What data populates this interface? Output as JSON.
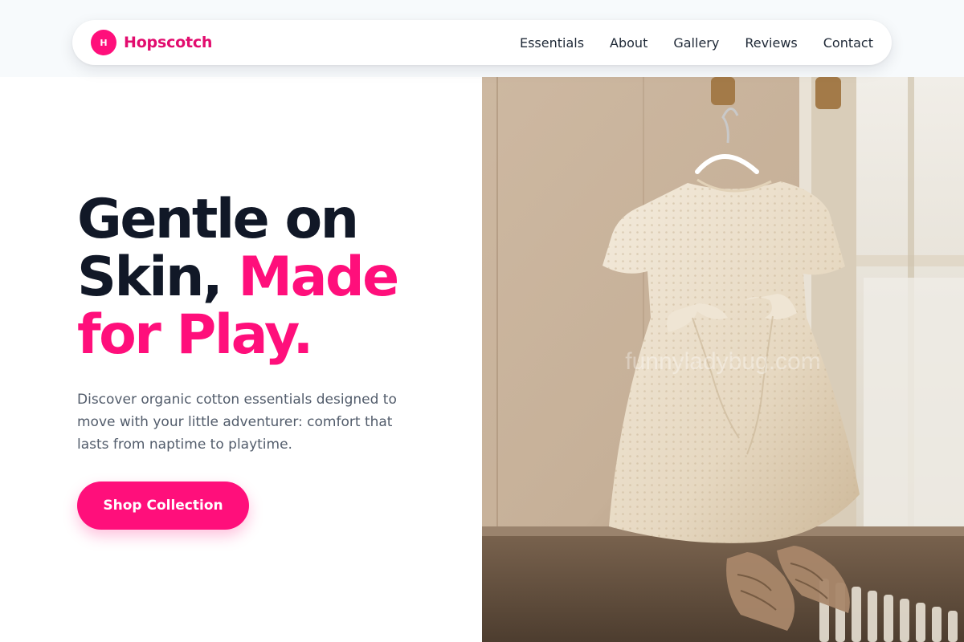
{
  "nav": {
    "logo_letter": "H",
    "brand": "Hopscotch",
    "links": [
      "Essentials",
      "About",
      "Gallery",
      "Reviews",
      "Contact"
    ]
  },
  "hero": {
    "headline_line1": "Gentle on",
    "headline_line2": "Skin, ",
    "headline_accent1": "Made",
    "headline_accent2": "for Play.",
    "subtext": "Discover organic cotton essentials designed to move with your little adventurer: comfort that lasts from naptime to playtime.",
    "cta_label": "Shop Collection",
    "image_watermark": "funnyladybug.com"
  },
  "colors": {
    "accent": "#ff0f7b",
    "brand_text": "#e20c6e",
    "headline": "#111827",
    "body_text": "#525c6b"
  }
}
